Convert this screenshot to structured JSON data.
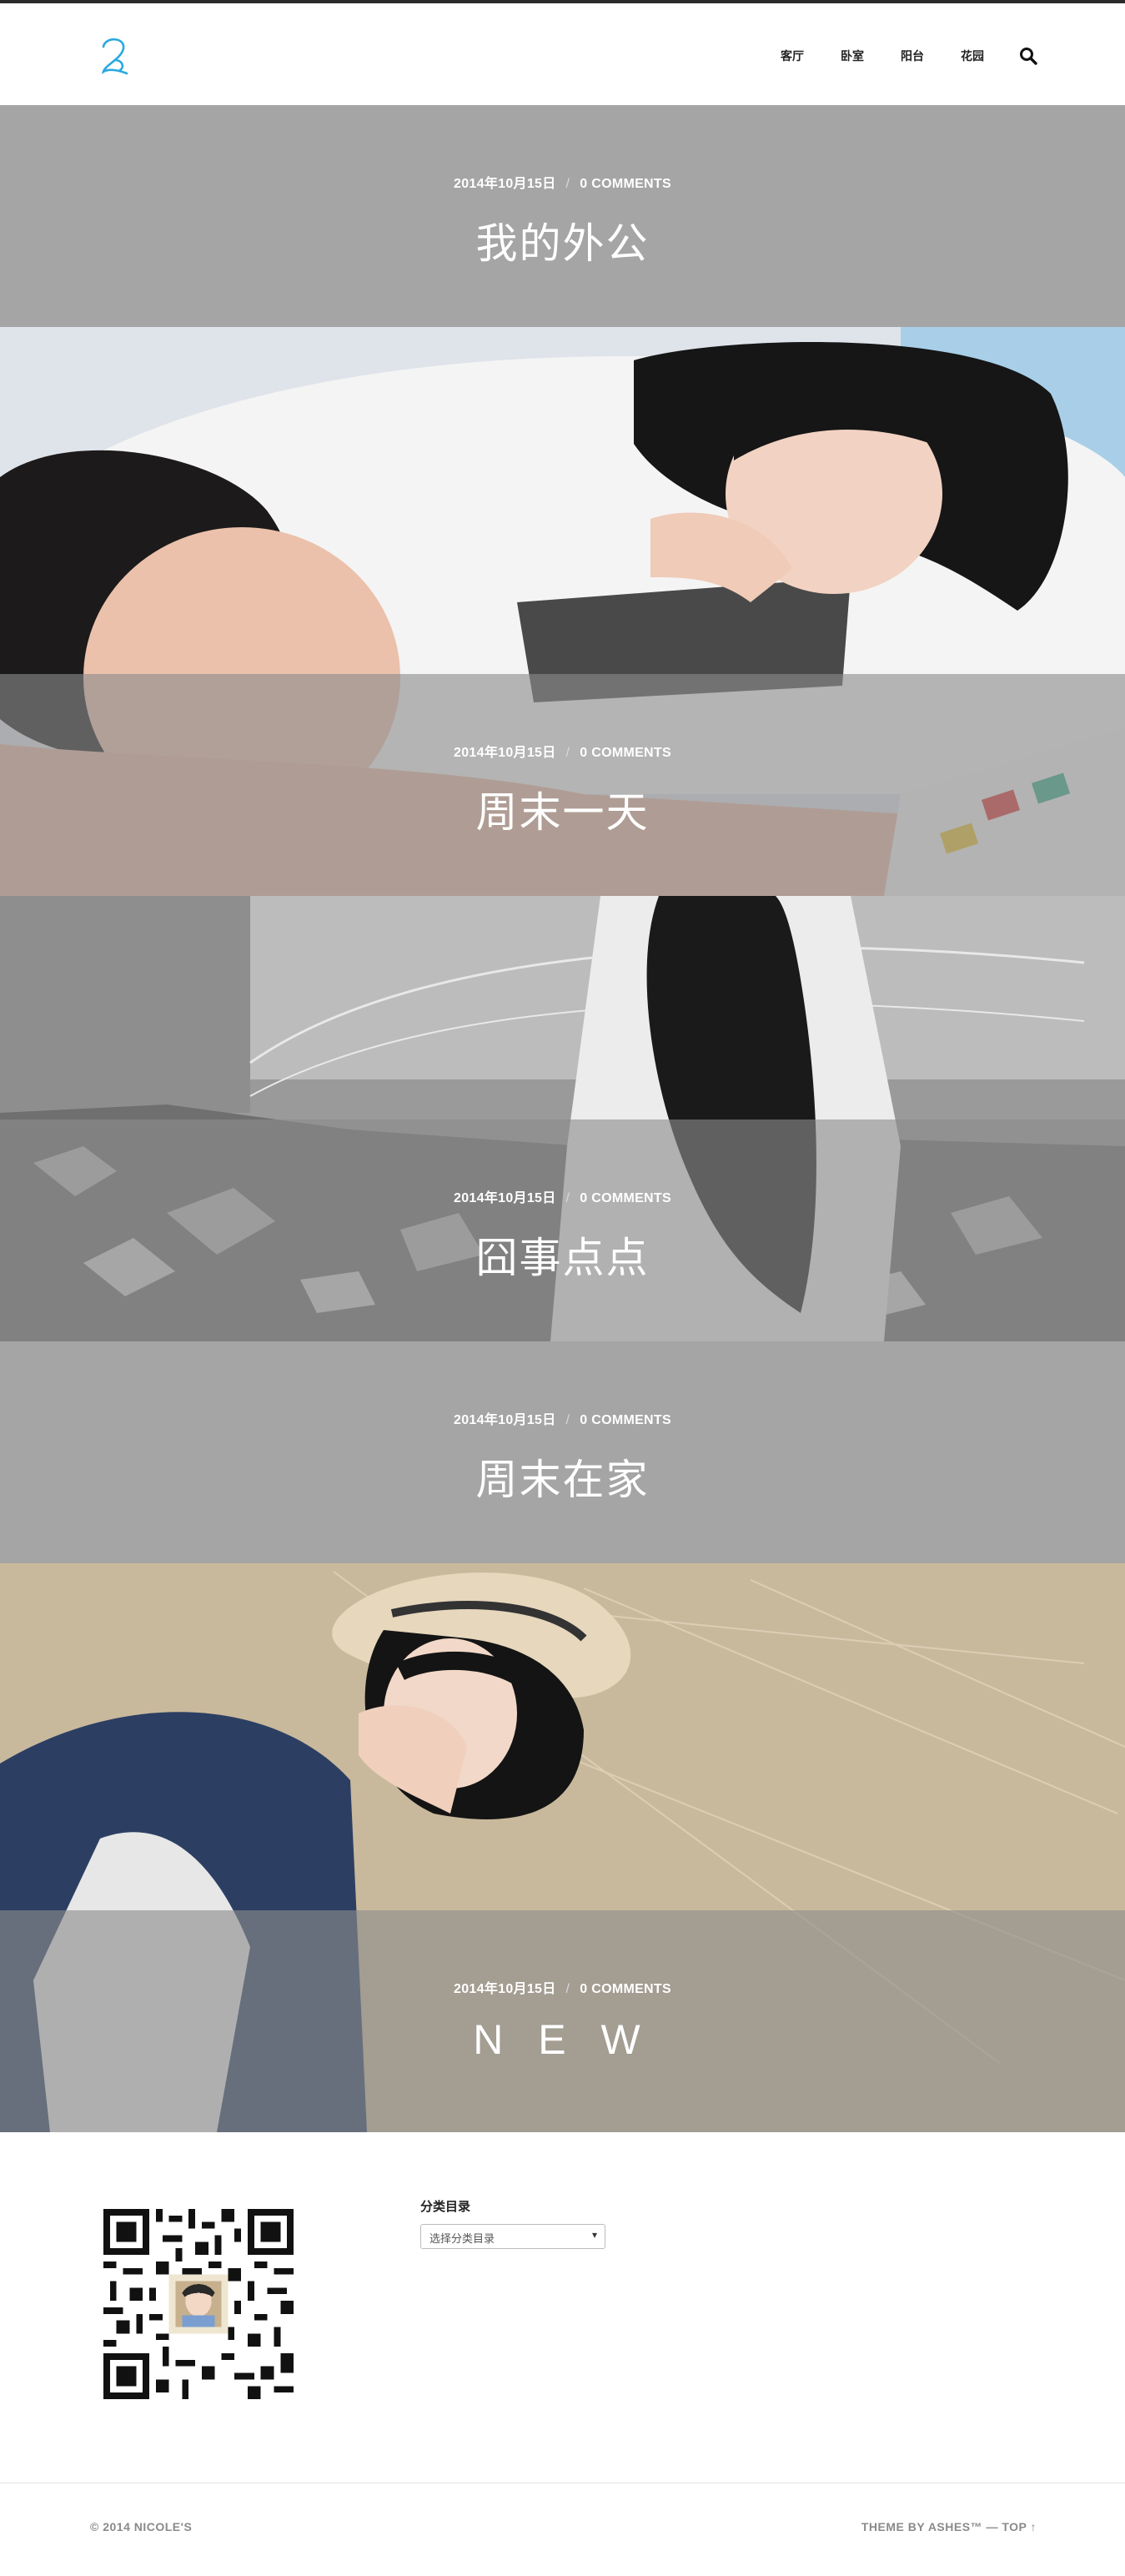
{
  "header": {
    "nav": [
      {
        "label": "客厅"
      },
      {
        "label": "卧室"
      },
      {
        "label": "阳台"
      },
      {
        "label": "花园"
      }
    ],
    "accent_color": "#29a9e0"
  },
  "posts": [
    {
      "date": "2014年10月15日",
      "comments": "0 COMMENTS",
      "title": "我的外公",
      "image": "none"
    },
    {
      "date": "2014年10月15日",
      "comments": "0 COMMENTS",
      "title": "周末一天",
      "image": "couple-lying-photo"
    },
    {
      "date": "2014年10月15日",
      "comments": "0 COMMENTS",
      "title": "囧事点点",
      "image": "girl-ruins-photo"
    },
    {
      "date": "2014年10月15日",
      "comments": "0 COMMENTS",
      "title": "周末在家",
      "image": "none"
    },
    {
      "date": "2014年10月15日",
      "comments": "0 COMMENTS",
      "title": "N E W",
      "image": "girl-hat-grass-photo"
    }
  ],
  "sidebar": {
    "categories_title": "分类目录",
    "categories_select": "选择分类目录"
  },
  "footer": {
    "copyright": "© 2014 NICOLE'S",
    "credit": "THEME BY ASHES™ — ",
    "top_link": "TOP ↑"
  }
}
